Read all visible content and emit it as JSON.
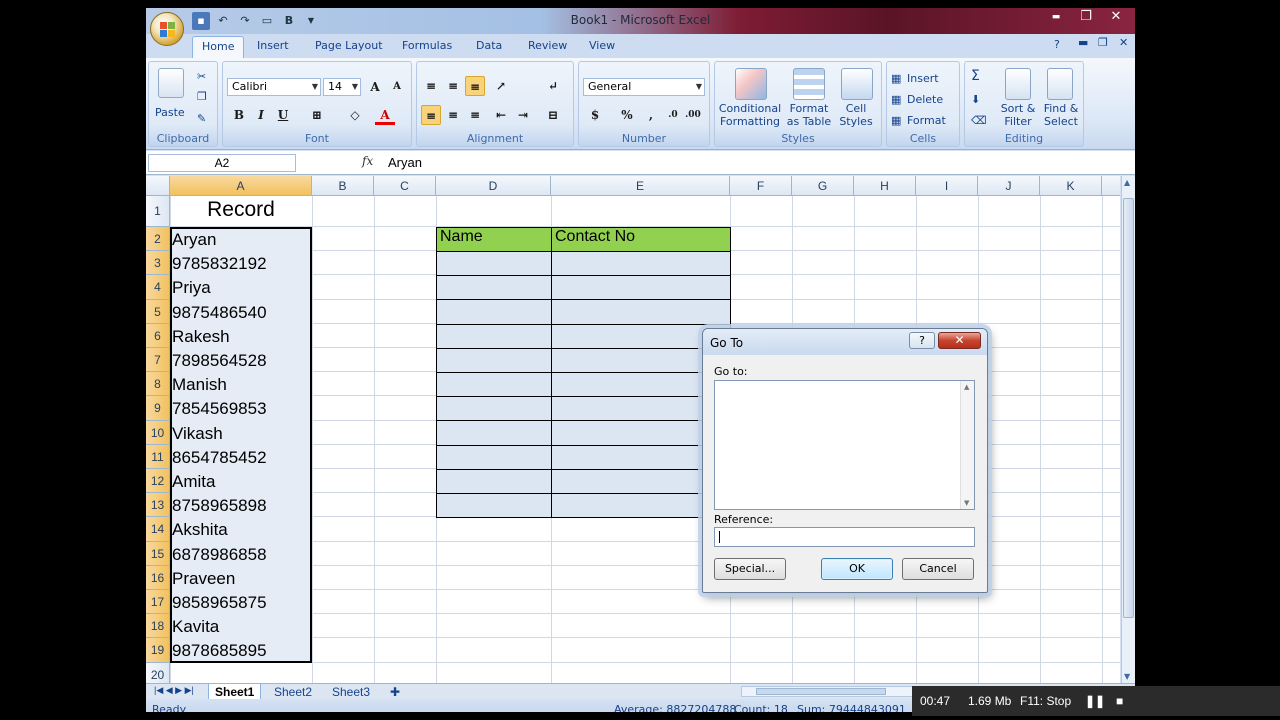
{
  "window": {
    "title": "Book1 - Microsoft Excel",
    "controls": {
      "minimize": "▬",
      "restore": "❐",
      "close": "✕"
    }
  },
  "ribbon_tabs": [
    "Home",
    "Insert",
    "Page Layout",
    "Formulas",
    "Data",
    "Review",
    "View"
  ],
  "ribbon": {
    "clipboard": {
      "label": "Clipboard",
      "paste": "Paste"
    },
    "font": {
      "label": "Font",
      "name": "Calibri",
      "size": "14",
      "grow": "A",
      "shrink": "A",
      "bold": "B",
      "italic": "I",
      "underline": "U"
    },
    "alignment": {
      "label": "Alignment"
    },
    "number": {
      "label": "Number",
      "format": "General",
      "currency": "$",
      "percent": "%",
      "comma": ","
    },
    "styles": {
      "label": "Styles",
      "conditional": "Conditional\nFormatting",
      "format_table": "Format\nas Table",
      "cell_styles": "Cell\nStyles"
    },
    "cells": {
      "label": "Cells",
      "insert": "Insert",
      "delete": "Delete",
      "format": "Format"
    },
    "editing": {
      "label": "Editing",
      "sigma": "Σ",
      "sort": "Sort &\nFilter",
      "find": "Find &\nSelect"
    }
  },
  "formula_bar": {
    "name_box": "A2",
    "fx": "fx",
    "content": "Aryan"
  },
  "columns": [
    "A",
    "B",
    "C",
    "D",
    "E",
    "F",
    "G",
    "H",
    "I",
    "J",
    "K"
  ],
  "rows": [
    "1",
    "2",
    "3",
    "4",
    "5",
    "6",
    "7",
    "8",
    "9",
    "10",
    "11",
    "12",
    "13",
    "14",
    "15",
    "16",
    "17",
    "18",
    "19",
    "20"
  ],
  "cells": {
    "A1": "Record",
    "column_a": [
      "Aryan",
      "9785832192",
      "Priya",
      "9875486540",
      "Rakesh",
      "7898564528",
      "Manish",
      "7854569853",
      "Vikash",
      "8654785452",
      "Amita",
      "8758965898",
      "Akshita",
      "6878986858",
      "Praveen",
      "9858965875",
      "Kavita",
      "9878685895"
    ],
    "D2": "Name",
    "E2": "Contact No"
  },
  "sheets": [
    "Sheet1",
    "Sheet2",
    "Sheet3"
  ],
  "status": {
    "ready": "Ready",
    "average": "Average: 8827204788",
    "count": "Count: 18",
    "sum": "Sum: 79444843091"
  },
  "recorder": {
    "time": "00:47",
    "size": "1.69 Mb",
    "stop": "F11: Stop"
  },
  "dialog": {
    "title": "Go To",
    "help": "?",
    "close": "✕",
    "goto_label": "Go to:",
    "reference_label": "Reference:",
    "reference_value": "",
    "special": "Special...",
    "ok": "OK",
    "cancel": "Cancel"
  },
  "colors": {
    "header_green": "#92d050",
    "table_fill": "#dce6f2",
    "selection_fill": "#e5ecf6"
  }
}
